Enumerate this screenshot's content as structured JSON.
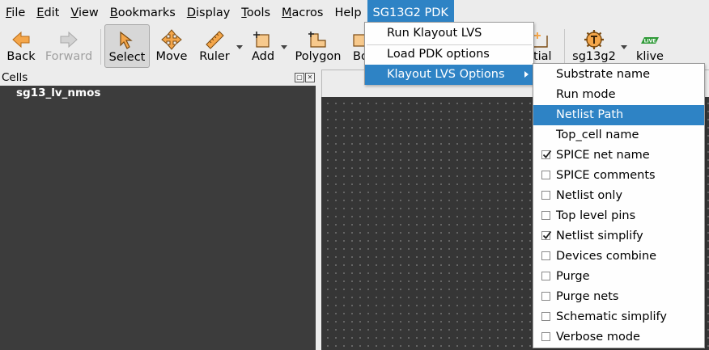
{
  "menubar": {
    "items": [
      {
        "mnemonic": "F",
        "rest": "ile"
      },
      {
        "mnemonic": "E",
        "rest": "dit"
      },
      {
        "mnemonic": "V",
        "rest": "iew"
      },
      {
        "mnemonic": "B",
        "rest": "ookmarks"
      },
      {
        "mnemonic": "D",
        "rest": "isplay"
      },
      {
        "mnemonic": "T",
        "rest": "ools"
      },
      {
        "mnemonic": "M",
        "rest": "acros"
      },
      {
        "mnemonic": "",
        "rest": "Help"
      },
      {
        "mnemonic": "",
        "rest": "SG13G2 PDK"
      }
    ]
  },
  "toolbar": {
    "back": "Back",
    "forward": "Forward",
    "select": "Select",
    "move": "Move",
    "ruler": "Ruler",
    "add": "Add",
    "polygon": "Polygon",
    "box_partial": "Bo",
    "partial": "rtial",
    "sg13g2": "sg13g2",
    "klive": "klive",
    "klive_badge": "LIVE"
  },
  "cells_panel": {
    "title": "Cells",
    "float_glyph": "▢",
    "close_glyph": "✕",
    "cell": "sg13_lv_nmos"
  },
  "pdk_menu": {
    "items": [
      "Run Klayout LVS",
      "Load PDK options",
      "Klayout LVS Options"
    ]
  },
  "lvs_options": {
    "items": [
      {
        "label": "Substrate name",
        "checkbox": false,
        "checked": false
      },
      {
        "label": "Run mode",
        "checkbox": false,
        "checked": false
      },
      {
        "label": "Netlist Path",
        "checkbox": false,
        "checked": false
      },
      {
        "label": "Top_cell name",
        "checkbox": false,
        "checked": false
      },
      {
        "label": "SPICE net name",
        "checkbox": true,
        "checked": true
      },
      {
        "label": "SPICE comments",
        "checkbox": true,
        "checked": false
      },
      {
        "label": "Netlist only",
        "checkbox": true,
        "checked": false
      },
      {
        "label": "Top level pins",
        "checkbox": true,
        "checked": false
      },
      {
        "label": "Netlist simplify",
        "checkbox": true,
        "checked": true
      },
      {
        "label": "Devices combine",
        "checkbox": true,
        "checked": false
      },
      {
        "label": "Purge",
        "checkbox": true,
        "checked": false
      },
      {
        "label": "Purge nets",
        "checkbox": true,
        "checked": false
      },
      {
        "label": "Schematic simplify",
        "checkbox": true,
        "checked": false
      },
      {
        "label": "Verbose mode",
        "checkbox": true,
        "checked": false
      }
    ]
  },
  "colors": {
    "highlight": "#2e83c5",
    "panel_bg": "#3c3c3c",
    "canvas_bg": "#363636"
  }
}
